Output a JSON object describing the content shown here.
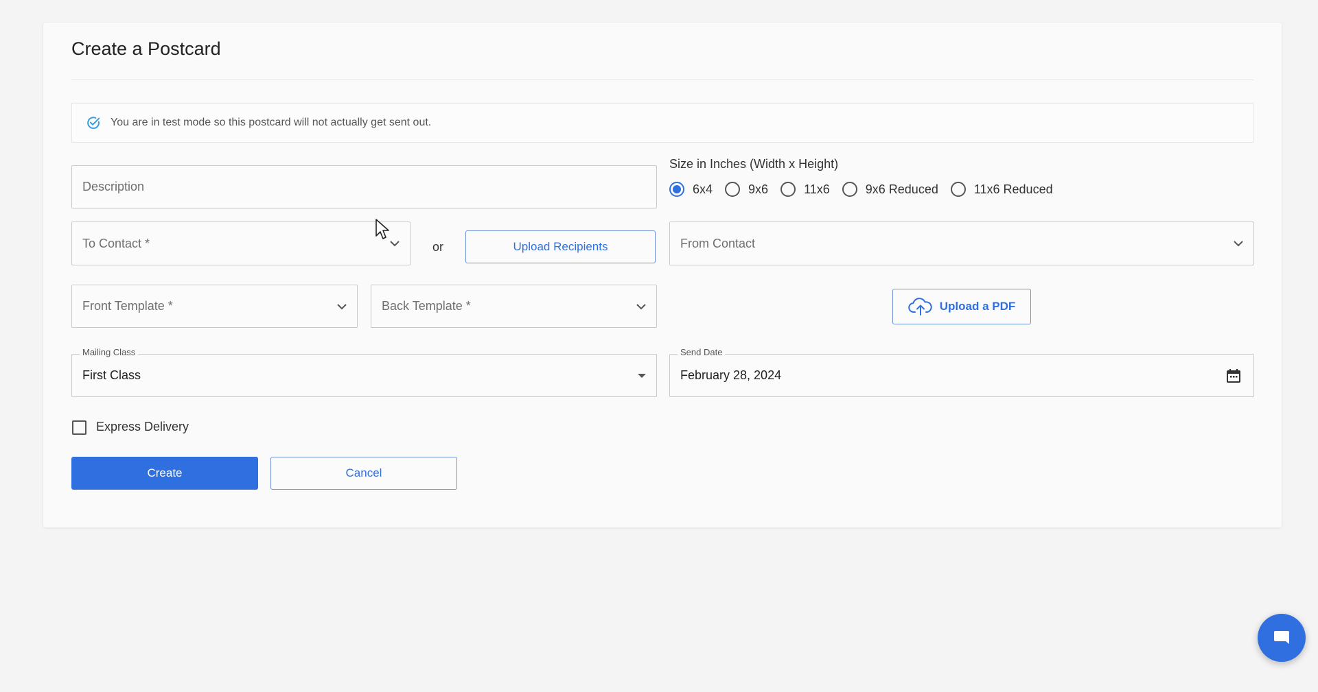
{
  "page": {
    "title": "Create a Postcard",
    "alert_text": "You are in test mode so this postcard will not actually get sent out."
  },
  "form": {
    "description_placeholder": "Description",
    "size_label": "Size in Inches (Width x Height)",
    "sizes": [
      {
        "label": "6x4",
        "checked": true
      },
      {
        "label": "9x6",
        "checked": false
      },
      {
        "label": "11x6",
        "checked": false
      },
      {
        "label": "9x6 Reduced",
        "checked": false
      },
      {
        "label": "11x6 Reduced",
        "checked": false
      }
    ],
    "to_contact_placeholder": "To Contact *",
    "or_text": "or",
    "upload_recipients_label": "Upload Recipients",
    "from_contact_placeholder": "From Contact",
    "front_template_placeholder": "Front Template *",
    "back_template_placeholder": "Back Template *",
    "upload_pdf_label": "Upload a PDF",
    "mailing_class_label": "Mailing Class",
    "mailing_class_value": "First Class",
    "send_date_label": "Send Date",
    "send_date_value": "February 28, 2024",
    "express_delivery_label": "Express Delivery",
    "express_delivery_checked": false,
    "create_label": "Create",
    "cancel_label": "Cancel"
  },
  "colors": {
    "accent": "#2f6fe0",
    "alert_icon": "#3a9fe0",
    "border": "#c9c9c9"
  },
  "icons": {
    "alert": "check-circle-icon",
    "dropdown": "chevron-down-icon",
    "upload": "cloud-upload-icon",
    "calendar": "calendar-icon",
    "chat": "chat-bubble-icon"
  }
}
